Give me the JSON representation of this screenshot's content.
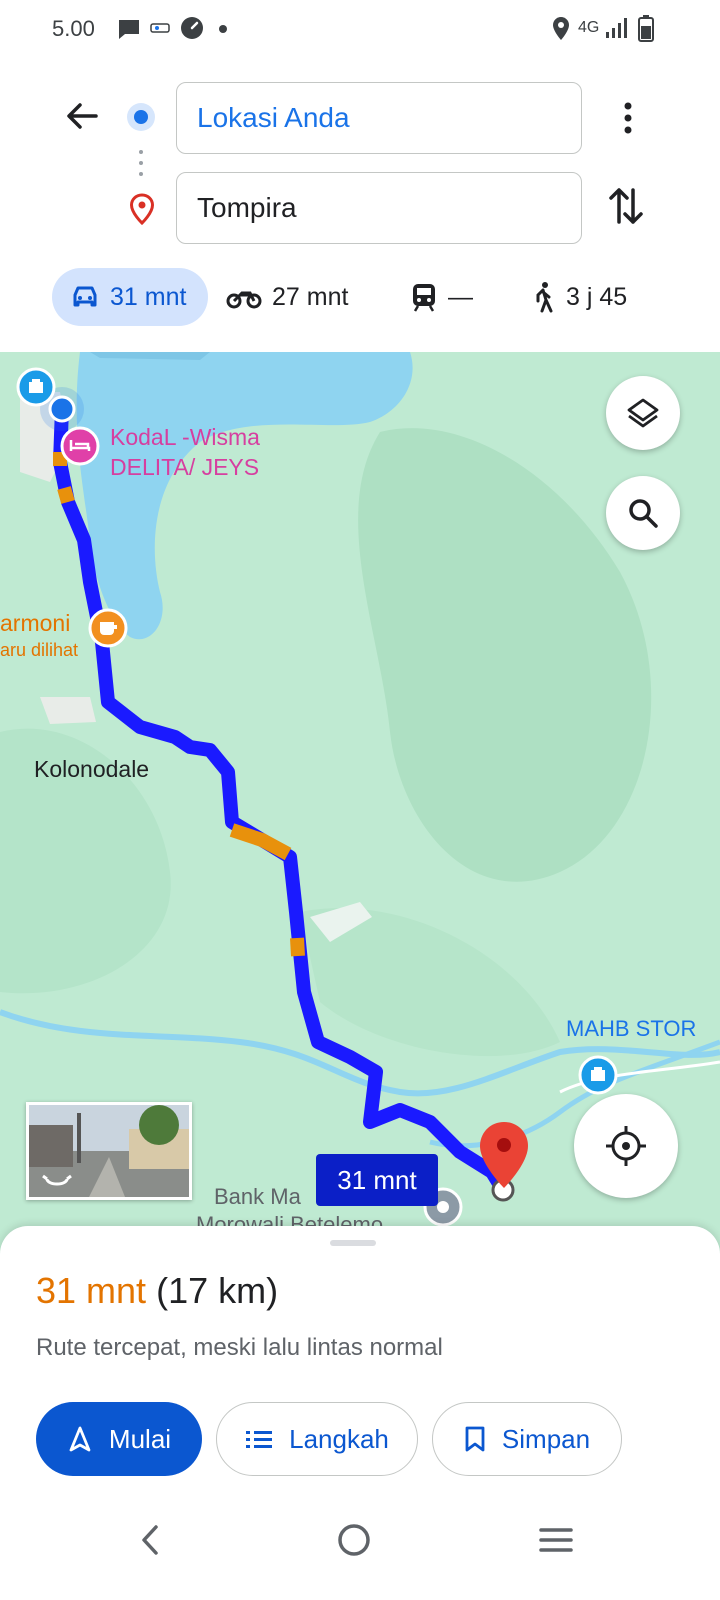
{
  "status_bar": {
    "time": "5.00",
    "network": "4G",
    "icons": [
      "message-icon",
      "app-icon",
      "speedometer-icon",
      "dot-icon",
      "location-icon",
      "signal-icon",
      "battery-icon"
    ]
  },
  "directions": {
    "origin": "Lokasi Anda",
    "destination": "Tompira"
  },
  "modes": [
    {
      "name": "car",
      "value": "31 mnt",
      "selected": true
    },
    {
      "name": "motorcycle",
      "value": "27 mnt",
      "selected": false
    },
    {
      "name": "transit",
      "value": "—",
      "selected": false
    },
    {
      "name": "walk",
      "value": "3 j 45",
      "selected": false
    }
  ],
  "map": {
    "labels": {
      "hotel": "KodaL -Wisma\nDELITA/ JEYS",
      "cafe_line1": "armoni",
      "cafe_line2": "aru dilihat",
      "town": "Kolonodale",
      "store": "MAHB STOR",
      "bank_line1": "Bank Ma",
      "bank_line2": "Morowali Betelemo"
    },
    "route_bubble": "31 mnt",
    "colors": {
      "route": "#1a1aff",
      "slow": "#e8910c",
      "water": "#8fd4f0",
      "land": "#bfead2",
      "poi_pink": "#e040a8",
      "poi_orange": "#f29020",
      "poi_blue": "#1a9be8",
      "pin_red": "#ea4335"
    }
  },
  "sheet": {
    "duration": "31 mnt",
    "distance": "(17 km)",
    "subtitle": "Rute tercepat, meski lalu lintas normal",
    "start_label": "Mulai",
    "steps_label": "Langkah",
    "save_label": "Simpan"
  }
}
